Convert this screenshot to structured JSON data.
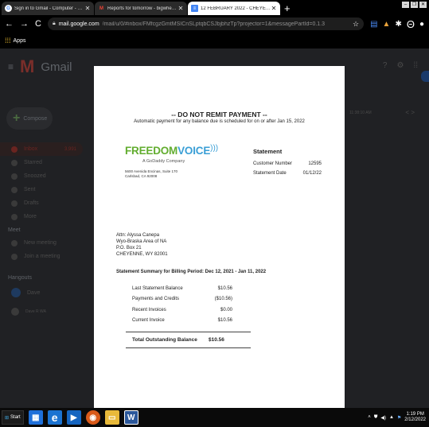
{
  "tabs": [
    {
      "title": "Sign in to Gmail - Computer - Gmail",
      "icon": "google-icon",
      "active": false
    },
    {
      "title": "Reports for tomorrow - bigwheels@",
      "icon": "gmail-icon",
      "active": false
    },
    {
      "title": "12 FEBRUARY 2022 - CHEYENNE",
      "icon": "document-icon",
      "active": true
    }
  ],
  "address": {
    "domain": "mail.google.com",
    "path": "/mail/u/0/#inbox/FMfcgzGmtMSICnSLptqbCSJbjbhzTp?projector=1&messagePartId=0.1.3"
  },
  "bookmarks": {
    "apps_label": "Apps"
  },
  "gmail": {
    "logo_text": "Gmail",
    "compose_label": "Compose",
    "nav": [
      {
        "label": "Inbox",
        "count": "3,991",
        "icon": "inbox-icon"
      },
      {
        "label": "Starred",
        "count": "",
        "icon": "star-icon"
      },
      {
        "label": "Snoozed",
        "count": "",
        "icon": "clock-icon"
      },
      {
        "label": "Sent",
        "count": "",
        "icon": "send-icon"
      },
      {
        "label": "Drafts",
        "count": "",
        "icon": "draft-icon"
      },
      {
        "label": "More",
        "count": "",
        "icon": "chevron-down-icon"
      }
    ],
    "meet_heading": "Meet",
    "meet_items": [
      {
        "label": "New meeting",
        "icon": "video-icon"
      },
      {
        "label": "Join a meeting",
        "icon": "keyboard-icon"
      }
    ],
    "hangouts_heading": "Hangouts",
    "hangouts_user": "Dave",
    "hangouts_contact": "Dave R WA",
    "right_snippet": "11:38:10 AM",
    "pagination": "< >"
  },
  "document": {
    "do_not_remit": "-- DO NOT REMIT PAYMENT --",
    "autopay_note": "Automatic payment for any balance due is scheduled for on or after Jan 15, 2022",
    "logo_word_1": "FREEDOM",
    "logo_word_2": "VOICE",
    "logo_sub": "A GoDaddy Company",
    "company_address_1": "5600 Avenida Encinas, Suite 170",
    "company_address_2": "Carlsbad, CA 92008",
    "statement_heading": "Statement",
    "customer_number_label": "Customer Number",
    "customer_number": "12595",
    "statement_date_label": "Statement Date",
    "statement_date": "01/12/22",
    "attn_lines": [
      "Attn: Alyssa Canepa",
      "Wyo-Braska Area of NA",
      "P.O. Box 21",
      "CHEYENNE, WY 82001"
    ],
    "summary_heading": "Statement Summary for Billing Period:  Dec 12, 2021 - Jan 11, 2022",
    "summary_rows": [
      {
        "label": "Last Statement Balance",
        "value": "$10.56"
      },
      {
        "label": "Payments and  Credits",
        "value": "($10.56)"
      },
      {
        "label": "Recent Invoices",
        "value": "$0.00"
      },
      {
        "label": "Current Invoice",
        "value": "$10.56"
      }
    ],
    "total_label": "Total Outstanding Balance",
    "total_value": "$10.56"
  },
  "taskbar": {
    "start_label": "Start",
    "time": "1:19 PM",
    "date": "2/12/2022"
  }
}
